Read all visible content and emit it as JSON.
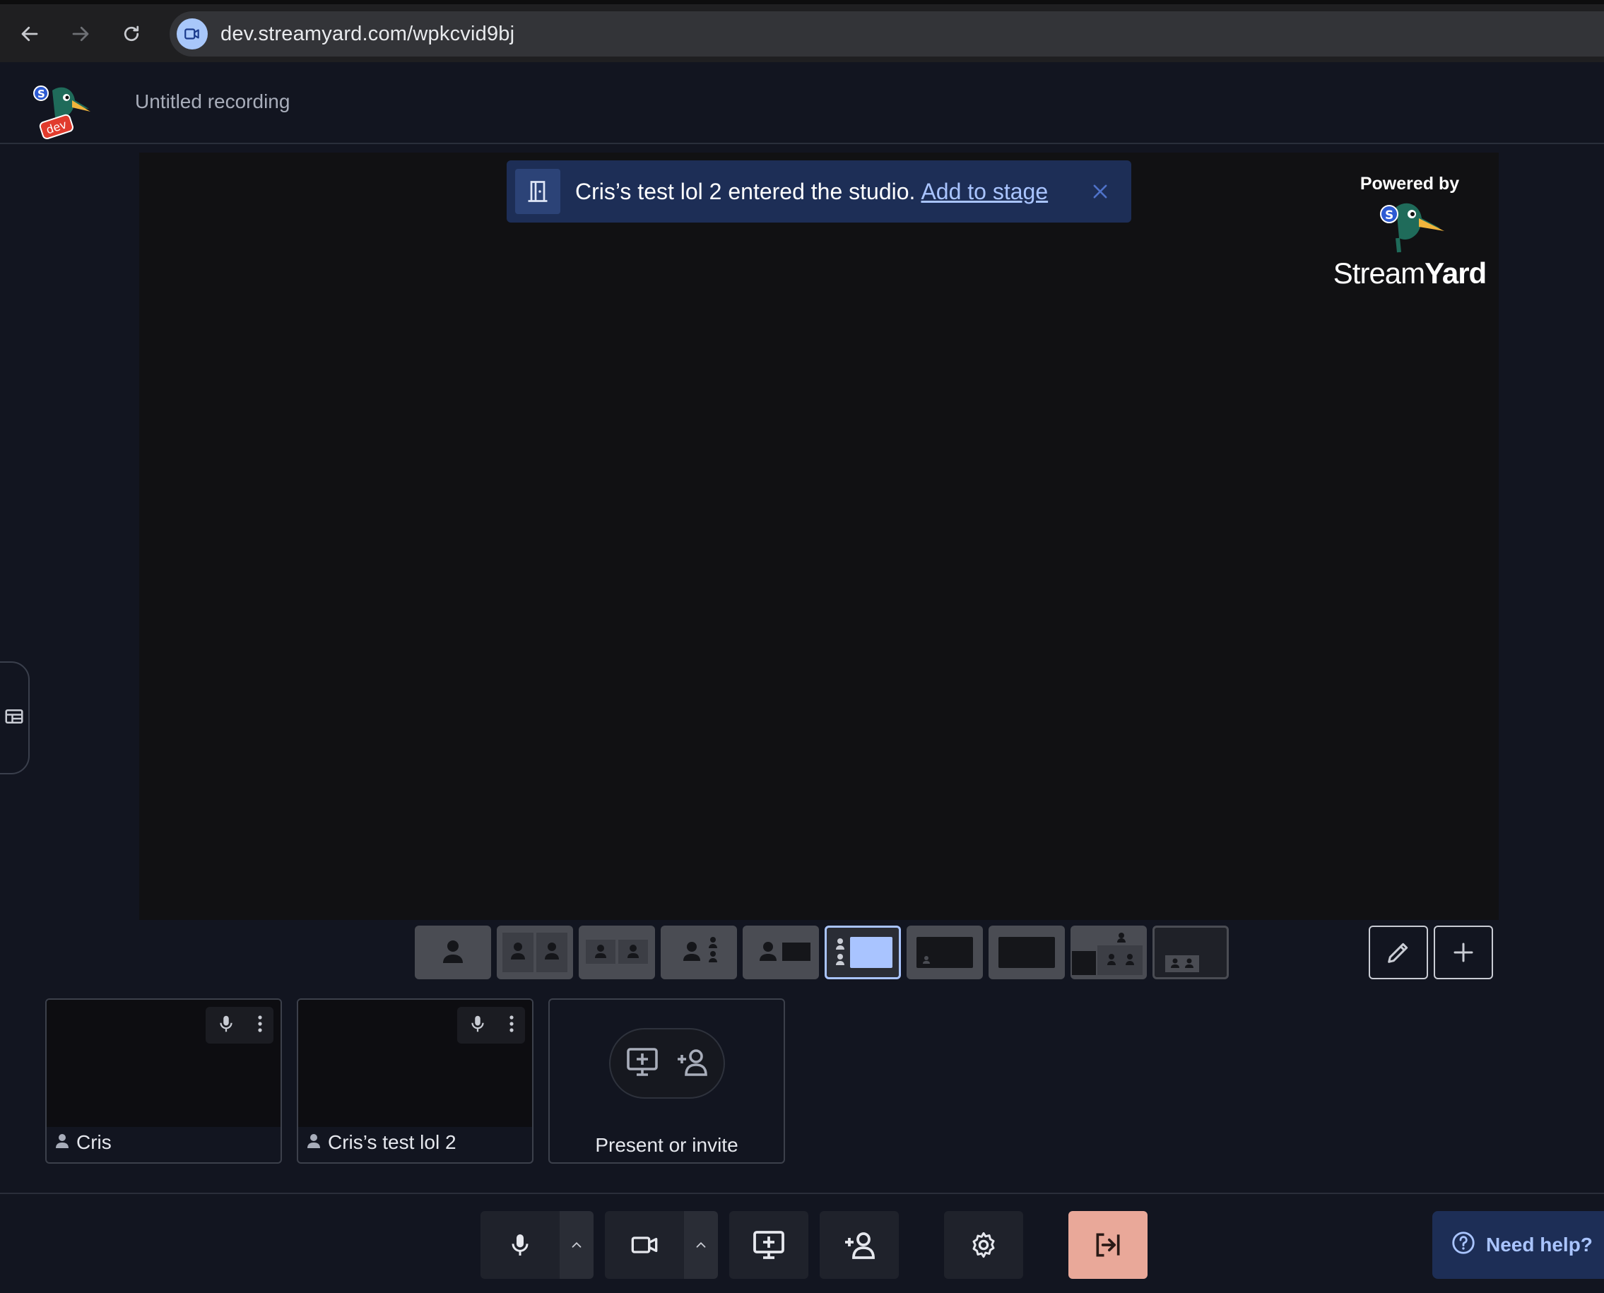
{
  "browser": {
    "url": "dev.streamyard.com/wpkcvid9bj"
  },
  "header": {
    "logo_badge": "dev",
    "recording_title": "Untitled recording"
  },
  "notification": {
    "message": "Cris’s test lol 2 entered the studio.",
    "action_label": "Add to stage"
  },
  "branding": {
    "powered_by": "Powered by",
    "name_regular": "Stream",
    "name_bold": "Yard"
  },
  "layouts": {
    "options": [
      "solo",
      "cropped",
      "group",
      "sidebar-people",
      "screen-solo",
      "screen-with-sidebar",
      "screen-lower",
      "screen-full",
      "picture-in-picture",
      "group-lower"
    ],
    "selected": "screen-with-sidebar"
  },
  "participants": [
    {
      "name": "Cris"
    },
    {
      "name": "Cris’s test lol 2"
    }
  ],
  "invite_tile": {
    "label": "Present or invite"
  },
  "help": {
    "label": "Need help?"
  },
  "colors": {
    "accent": "#a9c4ff",
    "leave": "#e9a899",
    "toast_bg": "#1d2e56"
  }
}
